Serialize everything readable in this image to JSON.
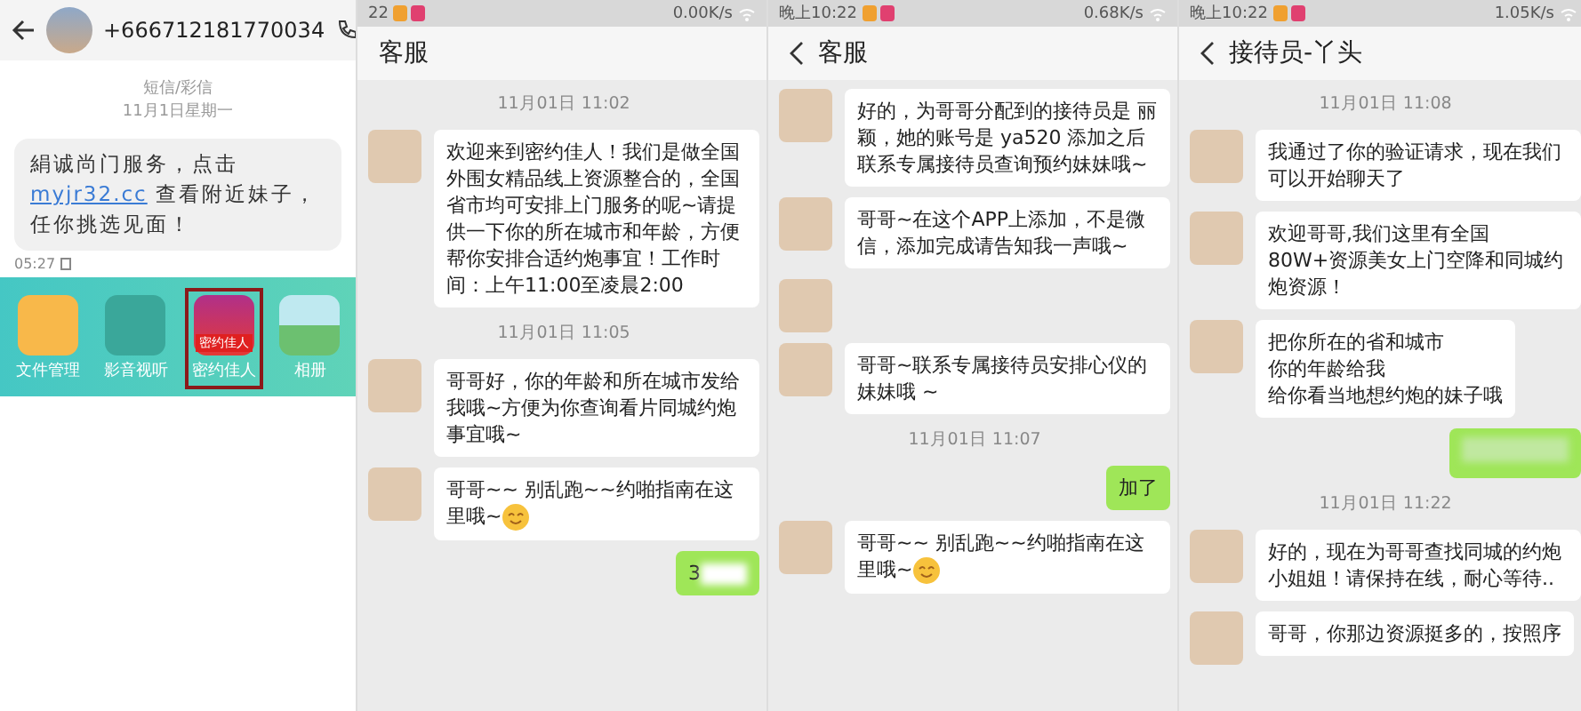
{
  "sms_screen": {
    "contact": "+666712181770034",
    "label": "短信/彩信",
    "date": "11月1日星期一",
    "message": {
      "before": "絹诚尚门服务，点击 ",
      "link": "myjr32.cc",
      "after": " 查看附近妹子，任你挑选见面！"
    },
    "time": "05:27",
    "apps": [
      {
        "label": "文件管理",
        "kind": "folder",
        "selected": false
      },
      {
        "label": "影音视听",
        "kind": "grid",
        "selected": false
      },
      {
        "label": "密约佳人",
        "kind": "app",
        "badge": "密约佳人",
        "selected": true
      },
      {
        "label": "相册",
        "kind": "photos",
        "selected": false
      }
    ]
  },
  "chats": [
    {
      "status_time": "22",
      "speed": "0.00K/s",
      "title": "客服",
      "back": false,
      "messages": [
        {
          "kind": "time",
          "text": "11月01日 11:02"
        },
        {
          "kind": "in",
          "text": "欢迎来到密约佳人！我们是做全国外围女精品线上资源整合的，全国省市均可安排上门服务的呢~请提供一下你的所在城市和年龄，方便帮你安排合适约炮事宜！工作时间：上午11:00至凌晨2:00"
        },
        {
          "kind": "time",
          "text": "11月01日 11:05"
        },
        {
          "kind": "in",
          "text": "哥哥好，你的年龄和所在城市发给我哦~方便为你查询看片同城约炮事宜哦~"
        },
        {
          "kind": "in",
          "text": "哥哥~~ 别乱跑~~约啪指南在这里哦~",
          "emoji": true
        },
        {
          "kind": "out",
          "text": "3",
          "blurred": true
        }
      ]
    },
    {
      "status_time": "晚上10:22",
      "speed": "0.68K/s",
      "title": "客服",
      "back": true,
      "messages": [
        {
          "kind": "in",
          "text": "好的，为哥哥分配到的接待员是 丽颖，她的账号是 ya520 添加之后联系专属接待员查询预约妹妹哦~"
        },
        {
          "kind": "in",
          "text": "哥哥~在这个APP上添加，不是微信，添加完成请告知我一声哦~"
        },
        {
          "kind": "in"
        },
        {
          "kind": "in",
          "text": "哥哥~联系专属接待员安排心仪的妹妹哦 ~"
        },
        {
          "kind": "time",
          "text": "11月01日 11:07"
        },
        {
          "kind": "out",
          "text": "加了"
        },
        {
          "kind": "in",
          "text": "哥哥~~ 别乱跑~~约啪指南在这里哦~",
          "emoji": true
        }
      ]
    },
    {
      "status_time": "晚上10:22",
      "speed": "1.05K/s",
      "title": "接待员-丫头",
      "back": true,
      "messages": [
        {
          "kind": "time",
          "text": "11月01日 11:08"
        },
        {
          "kind": "in",
          "text": "我通过了你的验证请求，现在我们可以开始聊天了"
        },
        {
          "kind": "in",
          "text": "欢迎哥哥,我们这里有全国80W+资源美女上门空降和同城约炮资源！"
        },
        {
          "kind": "in",
          "lines": [
            "把你所在的省和城市",
            "你的年龄给我",
            "给你看当地想约炮的妹子哦"
          ]
        },
        {
          "kind": "out",
          "blurred": true
        },
        {
          "kind": "time",
          "text": "11月01日 11:22"
        },
        {
          "kind": "in",
          "text": "好的，现在为哥哥查找同城的约炮小姐姐！请保持在线，耐心等待.."
        },
        {
          "kind": "in",
          "text": "哥哥，你那边资源挺多的，按照序"
        }
      ]
    }
  ]
}
